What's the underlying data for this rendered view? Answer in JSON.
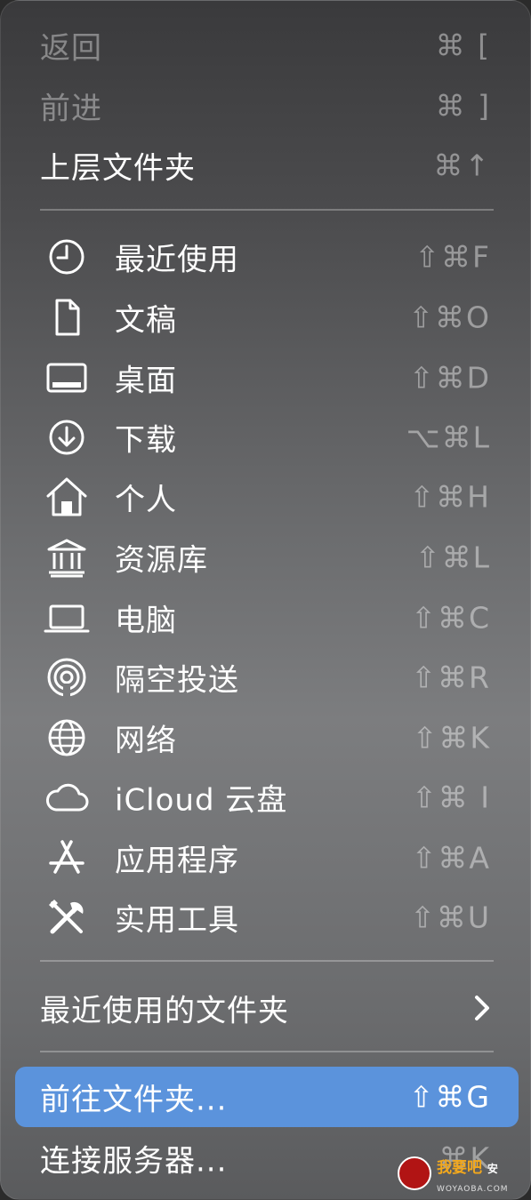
{
  "menu": {
    "nav_items": [
      {
        "label": "返回",
        "shortcut": "⌘ [",
        "enabled": false
      },
      {
        "label": "前进",
        "shortcut": "⌘ ]",
        "enabled": false
      },
      {
        "label": "上层文件夹",
        "shortcut": "⌘↑",
        "enabled": true
      }
    ],
    "locations": [
      {
        "label": "最近使用",
        "shortcut": "⇧⌘F",
        "icon": "clock-icon"
      },
      {
        "label": "文稿",
        "shortcut": "⇧⌘O",
        "icon": "document-icon"
      },
      {
        "label": "桌面",
        "shortcut": "⇧⌘D",
        "icon": "desktop-icon"
      },
      {
        "label": "下载",
        "shortcut": "⌥⌘L",
        "icon": "download-icon"
      },
      {
        "label": "个人",
        "shortcut": "⇧⌘H",
        "icon": "home-icon"
      },
      {
        "label": "资源库",
        "shortcut": "⇧⌘L",
        "icon": "library-icon"
      },
      {
        "label": "电脑",
        "shortcut": "⇧⌘C",
        "icon": "laptop-icon"
      },
      {
        "label": "隔空投送",
        "shortcut": "⇧⌘R",
        "icon": "airdrop-icon"
      },
      {
        "label": "网络",
        "shortcut": "⇧⌘K",
        "icon": "globe-icon"
      },
      {
        "label": "iCloud 云盘",
        "shortcut": "⇧⌘ I",
        "icon": "cloud-icon"
      },
      {
        "label": "应用程序",
        "shortcut": "⇧⌘A",
        "icon": "app-store-icon"
      },
      {
        "label": "实用工具",
        "shortcut": "⇧⌘U",
        "icon": "tools-icon"
      }
    ],
    "recent_folders": {
      "label": "最近使用的文件夹",
      "icon": "chevron-right-icon"
    },
    "go_to_folder": {
      "label": "前往文件夹...",
      "shortcut": "⇧⌘G",
      "highlighted": true
    },
    "connect_server": {
      "label": "连接服务器...",
      "shortcut": "⌘K"
    }
  },
  "watermark": {
    "text": "我要吧",
    "suffix": "安",
    "url": "WOYAOBA.COM"
  },
  "colors": {
    "highlight": "#5b93dc",
    "text": "#ffffff",
    "shortcut": "rgba(255,255,255,0.42)"
  }
}
